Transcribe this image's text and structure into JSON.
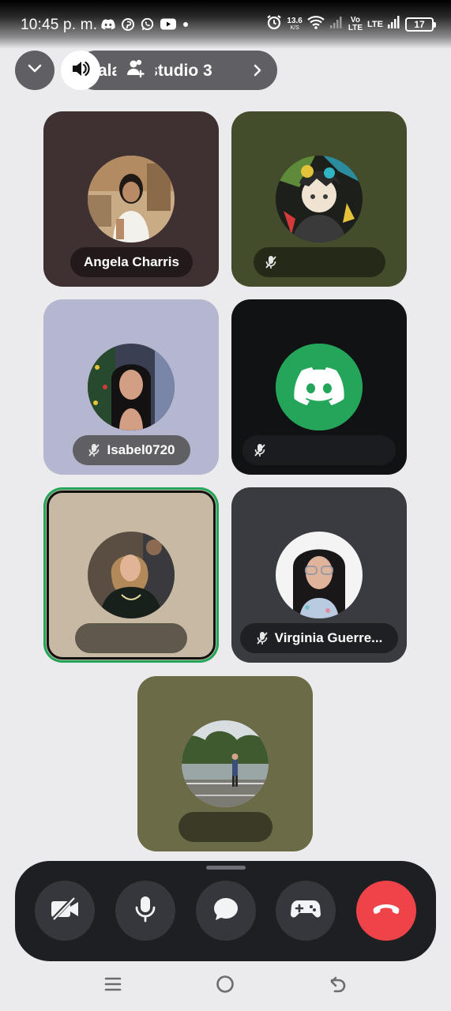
{
  "status_bar": {
    "time": "10:45 p. m.",
    "net_speed_value": "13.6",
    "net_speed_unit": "K/S",
    "volte_top": "Vo",
    "volte_bottom": "LTE",
    "lte": "LTE",
    "battery": "17",
    "notification_icons": [
      "discord-icon",
      "pinterest-icon",
      "whatsapp-icon",
      "youtube-icon",
      "dot-icon"
    ],
    "system_icons": [
      "alarm-icon",
      "wifi-icon",
      "signal-icon"
    ]
  },
  "header": {
    "channel_name": "Sala de estudio 3",
    "channel_name_visible": "ala  e estudio 3"
  },
  "tiles": [
    {
      "name": "Angela Charris",
      "muted": false,
      "bg": "#3f3131",
      "avatar": "woman-photo"
    },
    {
      "name": "",
      "muted": true,
      "bg": "#434d2b",
      "avatar": "anime-art"
    },
    {
      "name": "Isabel0720",
      "muted": true,
      "bg": "#b5b6cf",
      "avatar": "woman-photo"
    },
    {
      "name": "",
      "muted": true,
      "bg": "#111214",
      "avatar": "discord-logo"
    },
    {
      "name": "",
      "muted": false,
      "bg": "#c7b9a4",
      "avatar": "woman-photo",
      "speaking": true
    },
    {
      "name": "Virginia Guerre...",
      "muted": true,
      "bg": "#3a3b40",
      "avatar": "woman-photo"
    },
    {
      "name": "",
      "muted": false,
      "bg": "#6b6b47",
      "avatar": "street-photo"
    }
  ],
  "controls": {
    "buttons": [
      "camera-off",
      "microphone",
      "chat",
      "activities",
      "end-call"
    ]
  },
  "colors": {
    "background": "#ebebee",
    "control_bar": "#1e1f22",
    "control_button": "#36373c",
    "end_call": "#ee4348",
    "speaking_ring": "#23a55a",
    "discord_green": "#23a55a"
  }
}
